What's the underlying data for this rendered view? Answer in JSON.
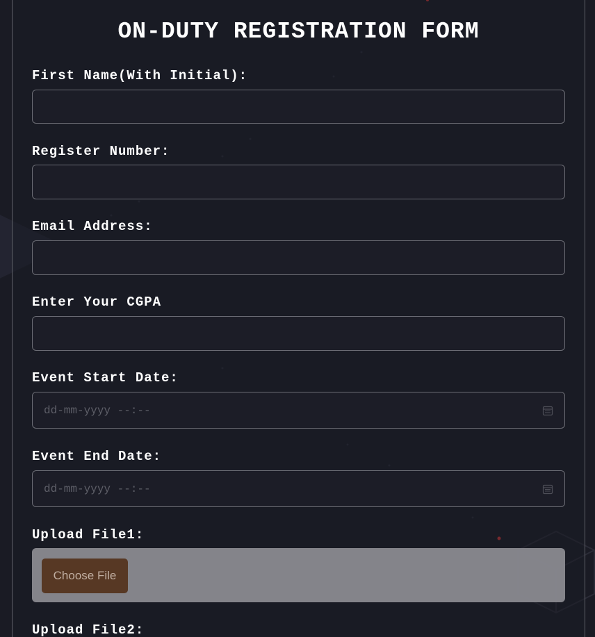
{
  "form": {
    "title": "ON-DUTY REGISTRATION FORM",
    "fields": [
      {
        "label": "First Name(With Initial):",
        "value": "",
        "type": "text"
      },
      {
        "label": "Register Number:",
        "value": "",
        "type": "text"
      },
      {
        "label": "Email Address:",
        "value": "",
        "type": "email"
      },
      {
        "label": "Enter Your CGPA",
        "value": "",
        "type": "text"
      },
      {
        "label": "Event Start Date:",
        "placeholder": "dd-mm-yyyy --:--",
        "type": "datetime",
        "icon": "calendar-icon"
      },
      {
        "label": "Event End Date:",
        "placeholder": "dd-mm-yyyy --:--",
        "type": "datetime",
        "icon": "calendar-icon"
      },
      {
        "label": "Upload File1:",
        "button_label": "Choose File",
        "type": "file"
      },
      {
        "label": "Upload File2:",
        "type": "file"
      }
    ]
  },
  "colors": {
    "background": "#1a1b24",
    "border": "#6b6c74",
    "button_bg": "#5b3a25",
    "file_box_bg": "#8a8a90",
    "accent_dot": "#e83a3a"
  }
}
